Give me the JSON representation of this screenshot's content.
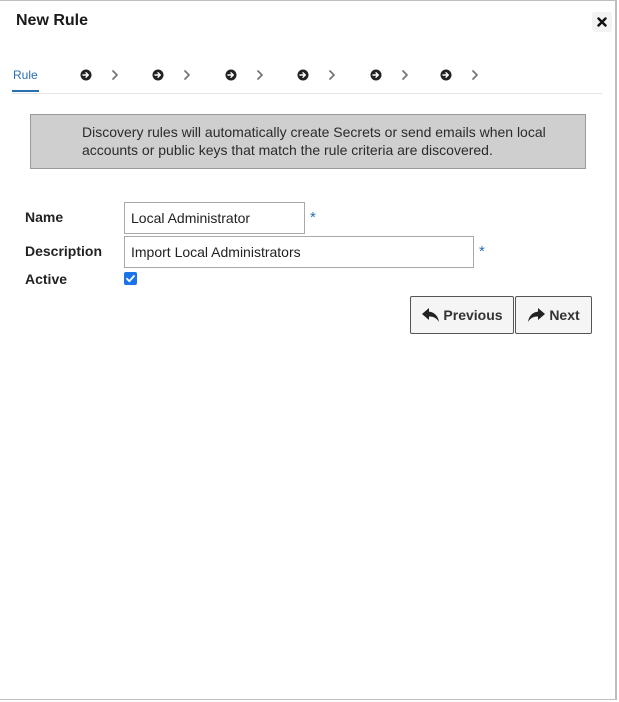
{
  "dialog": {
    "title": "New Rule",
    "close_icon": "close-icon"
  },
  "steps": {
    "active_label": "Rule",
    "pending_count_icons": [
      "arrow-circle-right-icon",
      "chevron-right-icon"
    ]
  },
  "info": {
    "text": "Discovery rules will automatically create Secrets or send emails when local accounts or public keys that match the rule criteria are discovered."
  },
  "form": {
    "name_label": "Name",
    "name_value": "Local Administrator",
    "description_label": "Description",
    "description_value": "Import Local Administrators",
    "active_label": "Active",
    "active_checked": true,
    "required_marker": "*"
  },
  "buttons": {
    "previous_label": "Previous",
    "next_label": "Next"
  },
  "colors": {
    "accent": "#2a6fb0",
    "info_bg": "#cfcfcf",
    "checkbox": "#1a73e8"
  }
}
